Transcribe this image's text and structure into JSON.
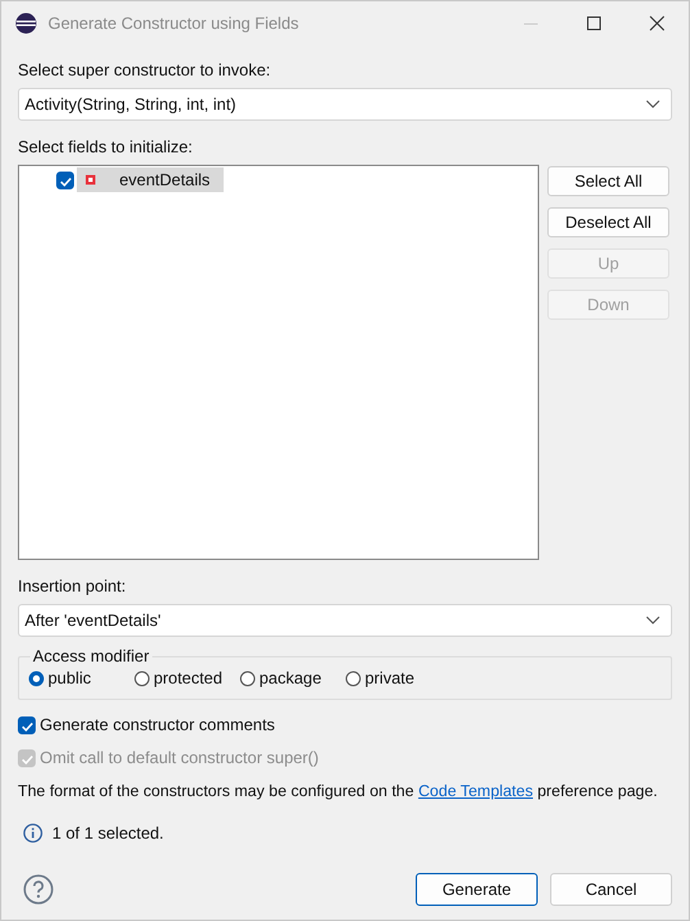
{
  "window": {
    "title": "Generate Constructor using Fields"
  },
  "super_constructor": {
    "label": "Select super constructor to invoke:",
    "value": "Activity(String, String, int, int)"
  },
  "fields": {
    "label": "Select fields to initialize:",
    "items": [
      {
        "name": "eventDetails",
        "checked": true,
        "selected": true
      }
    ]
  },
  "side_buttons": [
    {
      "label": "Select All",
      "disabled": false
    },
    {
      "label": "Deselect All",
      "disabled": false
    },
    {
      "label": "Up",
      "disabled": true
    },
    {
      "label": "Down",
      "disabled": true
    }
  ],
  "insertion_point": {
    "label": "Insertion point:",
    "value": "After 'eventDetails'"
  },
  "access_modifier": {
    "label": "Access modifier",
    "options": [
      {
        "label": "public",
        "selected": true
      },
      {
        "label": "protected",
        "selected": false
      },
      {
        "label": "package",
        "selected": false
      },
      {
        "label": "private",
        "selected": false
      }
    ]
  },
  "options": [
    {
      "label": "Generate constructor comments",
      "checked": true,
      "disabled": false
    },
    {
      "label": "Omit call to default constructor super()",
      "checked": true,
      "disabled": true
    }
  ],
  "note": {
    "before": "The format of the constructors may be configured on the",
    "link": "Code Templates",
    "after": "preference page."
  },
  "status": "1 of 1 selected.",
  "footer_buttons": [
    {
      "label": "Generate",
      "default": true
    },
    {
      "label": "Cancel",
      "default": false
    }
  ]
}
